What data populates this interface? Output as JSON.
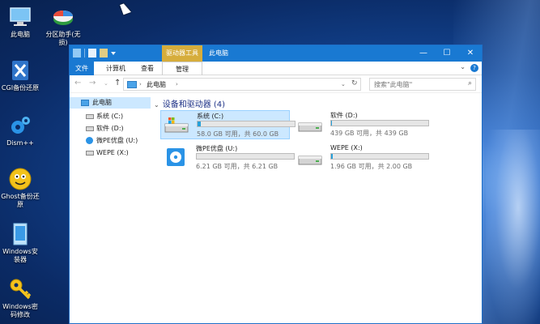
{
  "desktop": {
    "icons": [
      {
        "label_line1": "此电脑",
        "label_line2": ""
      },
      {
        "label_line1": "分区助手(无",
        "label_line2": "损)"
      },
      {
        "label_line1": "CGI备份还原",
        "label_line2": ""
      },
      {
        "label_line1": "Dism++",
        "label_line2": ""
      },
      {
        "label_line1": "Ghost备份还",
        "label_line2": "原"
      },
      {
        "label_line1": "Windows安",
        "label_line2": "装器"
      },
      {
        "label_line1": "Windows密",
        "label_line2": "码修改"
      }
    ]
  },
  "window": {
    "tool_tab": "驱动器工具",
    "title": "此电脑",
    "controls": {
      "minimize": "—",
      "maximize": "☐",
      "close": "✕"
    }
  },
  "ribbon": {
    "tabs": [
      "文件",
      "计算机",
      "查看",
      "管理"
    ],
    "collapse": "⌄",
    "help": "?"
  },
  "address": {
    "back": "←",
    "forward": "→",
    "recent": "⌄",
    "up": "↑",
    "path": "此电脑",
    "refresh": "↻",
    "search_placeholder": "搜索\"此电脑\""
  },
  "nav_pane": {
    "items": [
      {
        "label": "此电脑",
        "icon": "computer-icon"
      },
      {
        "label": "系统 (C:)",
        "icon": "drive-icon"
      },
      {
        "label": "软件 (D:)",
        "icon": "drive-icon"
      },
      {
        "label": "微PE优盘 (U:)",
        "icon": "disc-drive-icon"
      },
      {
        "label": "WEPE (X:)",
        "icon": "drive-icon"
      }
    ]
  },
  "content": {
    "group_header": "设备和驱动器 (4)",
    "drives": [
      {
        "name": "系统 (C:)",
        "info": "58.0 GB 可用，共 60.0 GB",
        "used_fraction": 0.03,
        "icon": "system-drive-icon"
      },
      {
        "name": "软件 (D:)",
        "info": "439 GB 可用，共 439 GB",
        "used_fraction": 0.01,
        "icon": "hard-drive-icon"
      },
      {
        "name": "微PE优盘 (U:)",
        "info": "6.21 GB 可用，共 6.21 GB",
        "used_fraction": 0.0,
        "icon": "disc-drive-icon"
      },
      {
        "name": "WEPE (X:)",
        "info": "1.96 GB 可用，共 2.00 GB",
        "used_fraction": 0.02,
        "icon": "hard-drive-icon"
      }
    ]
  },
  "colors": {
    "accent": "#1979d2",
    "tool_tab": "#d6ad3c",
    "selection": "#cce8ff",
    "bar_fill": "#26a0da"
  }
}
